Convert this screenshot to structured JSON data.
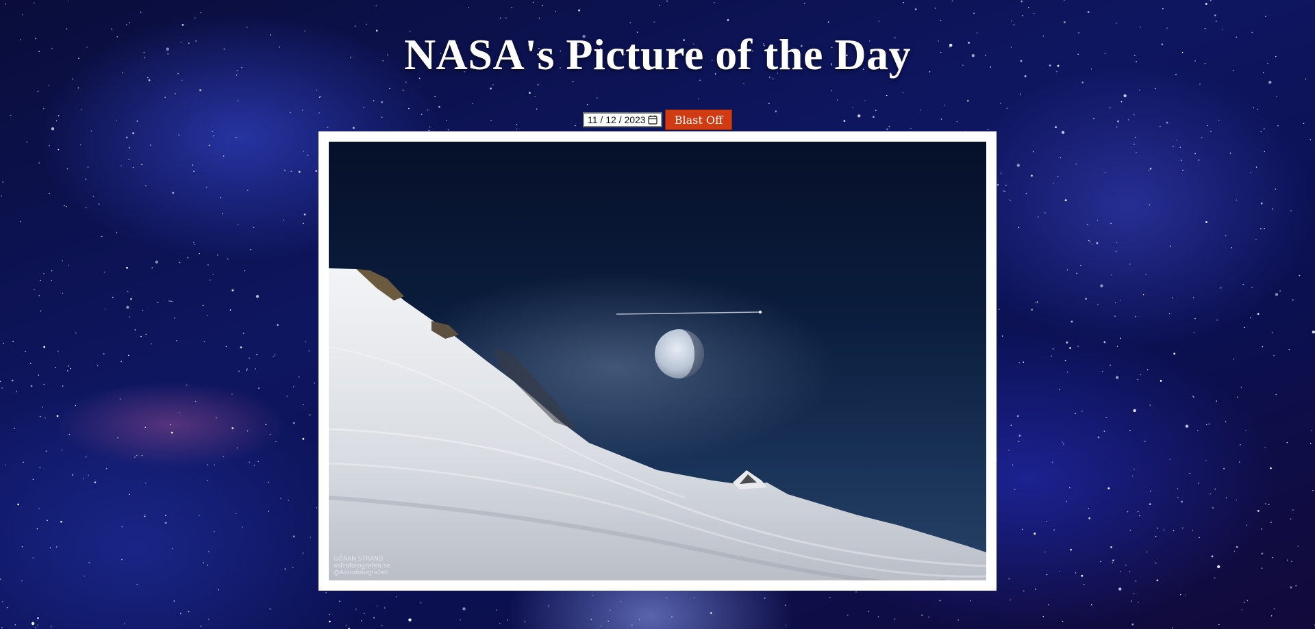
{
  "page": {
    "title": "NASA's Picture of the Day"
  },
  "controls": {
    "date_value": "11 / 12 / 2023",
    "date_picker_icon": "calendar-icon",
    "submit_label": "Blast Off"
  },
  "apod": {
    "image_alt": "Moon rising over a snowy mountain slope with an airplane contrail",
    "credit_lines": [
      "GÖRAN STRAND",
      "astrofotografen.se",
      "@Astrofotografen"
    ]
  },
  "colors": {
    "button": "#d23a12",
    "frame": "#ffffff",
    "title": "#ffffff"
  }
}
